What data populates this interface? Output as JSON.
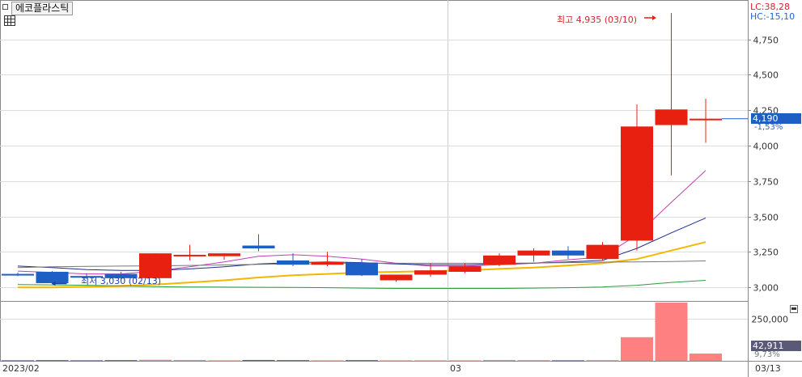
{
  "header": {
    "stock_name": "에코플라스틱",
    "lc_label": "LC:38,28",
    "hc_label": "HC:-15,10"
  },
  "price_panel": {
    "current_price_label": "4,190",
    "change_label": "-1,53%",
    "high_annotation": "최고 4,935 (03/10)",
    "low_annotation": "최저 3,030 (02/13)"
  },
  "volume_panel": {
    "current_volume_label": "42,911",
    "volume_pct_label": "9,73%"
  },
  "time_axis": {
    "left_label": "2023/02",
    "mid_label": "03",
    "right_label": "03/13"
  },
  "colors": {
    "up": "#e8200f",
    "down": "#1e5fc5",
    "ma_fast": "#c33fb6",
    "ma_mid": "#1a2e8c",
    "ma_gold": "#f2b800",
    "ma_gray": "#777777",
    "ma_green": "#2e9a45",
    "vol_up": "#ff8080",
    "vol_down": "#5a5a90"
  },
  "chart_data": {
    "type": "candlestick",
    "y_axis": {
      "range": [
        2910,
        5010
      ],
      "ticks": [
        3000,
        3250,
        3500,
        3750,
        4000,
        4250,
        4500,
        4750
      ],
      "tick_labels": [
        "3,000",
        "3,250",
        "3,500",
        "3,750",
        "4,000",
        "4,250",
        "4,500",
        "4,750"
      ]
    },
    "volume_axis": {
      "range": [
        0,
        350000
      ],
      "ticks": [
        250000
      ],
      "tick_labels": [
        "250,000"
      ]
    },
    "candles": [
      {
        "open": 3095,
        "high": 3105,
        "low": 3080,
        "close": 3085,
        "volume": 3000
      },
      {
        "open": 3110,
        "high": 3115,
        "low": 3030,
        "close": 3030,
        "volume": 4000
      },
      {
        "open": 3080,
        "high": 3100,
        "low": 3060,
        "close": 3070,
        "volume": 3000
      },
      {
        "open": 3095,
        "high": 3110,
        "low": 3060,
        "close": 3065,
        "volume": 4000
      },
      {
        "open": 3065,
        "high": 3240,
        "low": 3060,
        "close": 3240,
        "volume": 6000
      },
      {
        "open": 3230,
        "high": 3300,
        "low": 3190,
        "close": 3230,
        "volume": 5000
      },
      {
        "open": 3220,
        "high": 3240,
        "low": 3195,
        "close": 3240,
        "volume": 3000
      },
      {
        "open": 3295,
        "high": 3375,
        "low": 3255,
        "close": 3275,
        "volume": 5000
      },
      {
        "open": 3190,
        "high": 3240,
        "low": 3150,
        "close": 3160,
        "volume": 4000
      },
      {
        "open": 3160,
        "high": 3250,
        "low": 3150,
        "close": 3180,
        "volume": 3000
      },
      {
        "open": 3175,
        "high": 3200,
        "low": 3080,
        "close": 3085,
        "volume": 4000
      },
      {
        "open": 3050,
        "high": 3090,
        "low": 3040,
        "close": 3090,
        "volume": 3000
      },
      {
        "open": 3090,
        "high": 3170,
        "low": 3075,
        "close": 3120,
        "volume": 3000
      },
      {
        "open": 3110,
        "high": 3170,
        "low": 3100,
        "close": 3150,
        "volume": 3000
      },
      {
        "open": 3160,
        "high": 3240,
        "low": 3150,
        "close": 3225,
        "volume": 5000
      },
      {
        "open": 3225,
        "high": 3275,
        "low": 3180,
        "close": 3260,
        "volume": 4000
      },
      {
        "open": 3260,
        "high": 3290,
        "low": 3200,
        "close": 3225,
        "volume": 3000
      },
      {
        "open": 3200,
        "high": 3320,
        "low": 3190,
        "close": 3300,
        "volume": 4000
      },
      {
        "open": 3330,
        "high": 4290,
        "low": 3260,
        "close": 4135,
        "volume": 140000
      },
      {
        "open": 4145,
        "high": 4935,
        "low": 3790,
        "close": 4255,
        "volume": 345000
      },
      {
        "open": 4190,
        "high": 4330,
        "low": 4020,
        "close": 4190,
        "volume": 42911
      }
    ],
    "moving_averages": [
      {
        "key": "ma_fast",
        "values": [
          3115,
          3105,
          3095,
          3095,
          3115,
          3145,
          3180,
          3220,
          3230,
          3220,
          3200,
          3170,
          3150,
          3150,
          3160,
          3170,
          3195,
          3215,
          3370,
          3600,
          3825
        ]
      },
      {
        "key": "ma_mid",
        "values": [
          3150,
          3140,
          3125,
          3120,
          3120,
          3130,
          3145,
          3165,
          3175,
          3180,
          3175,
          3165,
          3160,
          3160,
          3165,
          3170,
          3180,
          3190,
          3275,
          3385,
          3490
        ]
      },
      {
        "key": "ma_gold",
        "values": [
          3000,
          3000,
          3005,
          3010,
          3020,
          3035,
          3050,
          3070,
          3085,
          3095,
          3105,
          3110,
          3115,
          3120,
          3130,
          3140,
          3155,
          3170,
          3200,
          3260,
          3320
        ]
      },
      {
        "key": "ma_gray",
        "values": [
          3140,
          3145,
          3148,
          3150,
          3152,
          3155,
          3158,
          3162,
          3165,
          3168,
          3170,
          3170,
          3170,
          3170,
          3170,
          3172,
          3175,
          3178,
          3180,
          3183,
          3187
        ]
      },
      {
        "key": "ma_green",
        "values": [
          3020,
          3018,
          3015,
          3010,
          3005,
          3003,
          3002,
          3001,
          3000,
          2998,
          2995,
          2993,
          2993,
          2993,
          2993,
          2995,
          2998,
          3003,
          3015,
          3035,
          3050
        ]
      }
    ]
  }
}
